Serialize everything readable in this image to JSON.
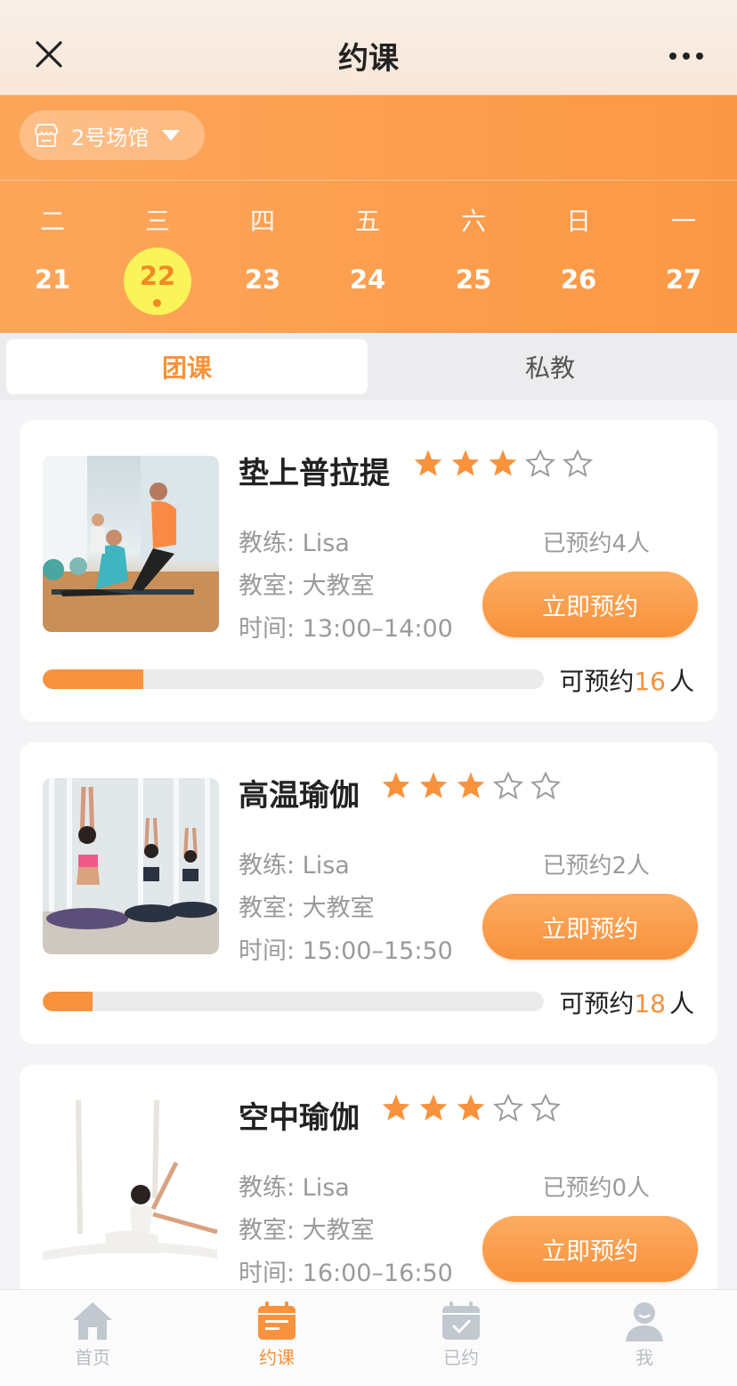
{
  "header": {
    "title": "约课"
  },
  "venue": {
    "label": "2号场馆"
  },
  "week": [
    {
      "weekday": "二",
      "day": "21"
    },
    {
      "weekday": "三",
      "day": "22"
    },
    {
      "weekday": "四",
      "day": "23"
    },
    {
      "weekday": "五",
      "day": "24"
    },
    {
      "weekday": "六",
      "day": "25"
    },
    {
      "weekday": "日",
      "day": "26"
    },
    {
      "weekday": "一",
      "day": "27"
    }
  ],
  "selected_day": "22",
  "tabs": [
    {
      "label": "团课",
      "active": true
    },
    {
      "label": "私教",
      "active": false
    }
  ],
  "courses": [
    {
      "name": "垫上普拉提",
      "rating": 3,
      "rating_max": 5,
      "coach": "教练:  Lisa",
      "room": "教室:  大教室",
      "time": "时间:  13:00–14:00",
      "booked": "已预约4人",
      "button": "立即预约",
      "avail_prefix": "可预约",
      "avail_num": "16",
      "avail_suffix": "人",
      "booked_fraction": 0.2
    },
    {
      "name": "高温瑜伽",
      "rating": 3,
      "rating_max": 5,
      "coach": "教练:  Lisa",
      "room": "教室:  大教室",
      "time": "时间:  15:00–15:50",
      "booked": "已预约2人",
      "button": "立即预约",
      "avail_prefix": "可预约",
      "avail_num": "18",
      "avail_suffix": "人",
      "booked_fraction": 0.1
    },
    {
      "name": "空中瑜伽",
      "rating": 3,
      "rating_max": 5,
      "coach": "教练:  Lisa",
      "room": "教室:  大教室",
      "time": "时间:  16:00–16:50",
      "booked": "已预约0人",
      "button": "立即预约"
    }
  ],
  "nav": [
    {
      "label": "首页",
      "icon": "home-icon",
      "active": false
    },
    {
      "label": "约课",
      "icon": "calendar-icon",
      "active": true
    },
    {
      "label": "已约",
      "icon": "calendar-check-icon",
      "active": false
    },
    {
      "label": "我",
      "icon": "user-icon",
      "active": false
    }
  ],
  "colors": {
    "accent": "#f6913a",
    "selected_day_bg": "#fbf35a",
    "inactive_nav": "#b8bdc6"
  }
}
